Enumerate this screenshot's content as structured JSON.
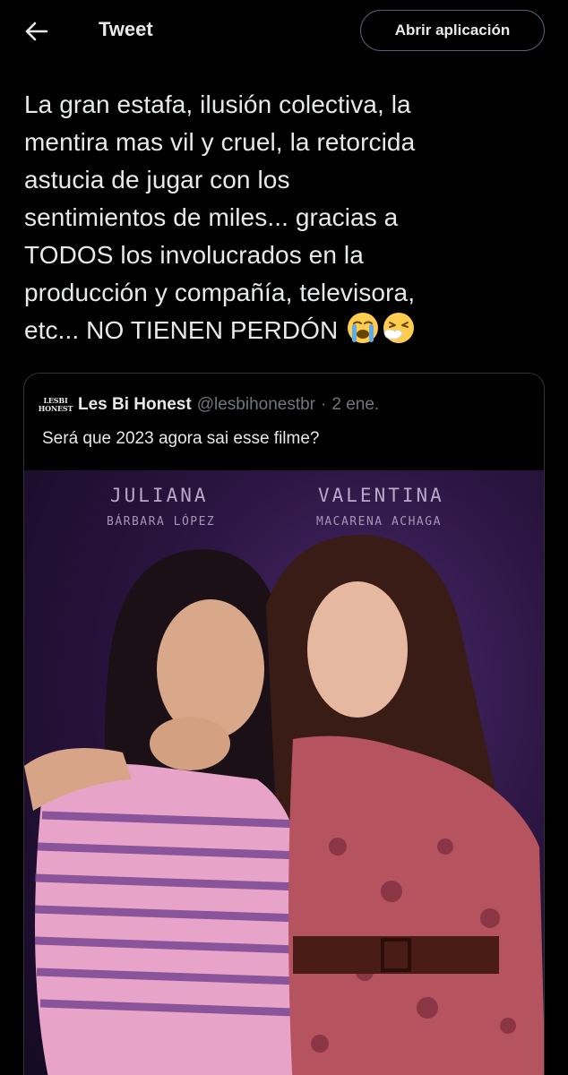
{
  "header": {
    "title": "Tweet",
    "open_app_label": "Abrir aplicación",
    "back_icon": "arrow-left-icon"
  },
  "tweet": {
    "lines": [
      "La gran estafa, ilusión colectiva, la",
      "mentira mas vil y cruel, la retorcida",
      "astucia de jugar con los",
      "sentimientos de miles... gracias a",
      "TODOS los involucrados en la",
      "producción y compañía, televisora,",
      "etc... NO TIENEN PERDÓN"
    ],
    "emojis": [
      "loudly-crying-face-icon",
      "sneezing-face-icon"
    ]
  },
  "quote": {
    "avatar_text_top": "LESBI",
    "avatar_text_bottom": "HONEST",
    "name": "Les Bi Honest",
    "handle": "@lesbihonestbr",
    "separator": "·",
    "date": "2 ene.",
    "text": "Será que 2023 agora sai esse filme?",
    "media": {
      "left_name": "JULIANA",
      "left_actor": "BÁRBARA LÓPEZ",
      "right_name": "VALENTINA",
      "right_actor": "MACARENA ACHAGA"
    }
  },
  "colors": {
    "background": "#000000",
    "text_primary": "#e7e9ea",
    "text_secondary": "#71767b",
    "border": "#2f3336"
  }
}
